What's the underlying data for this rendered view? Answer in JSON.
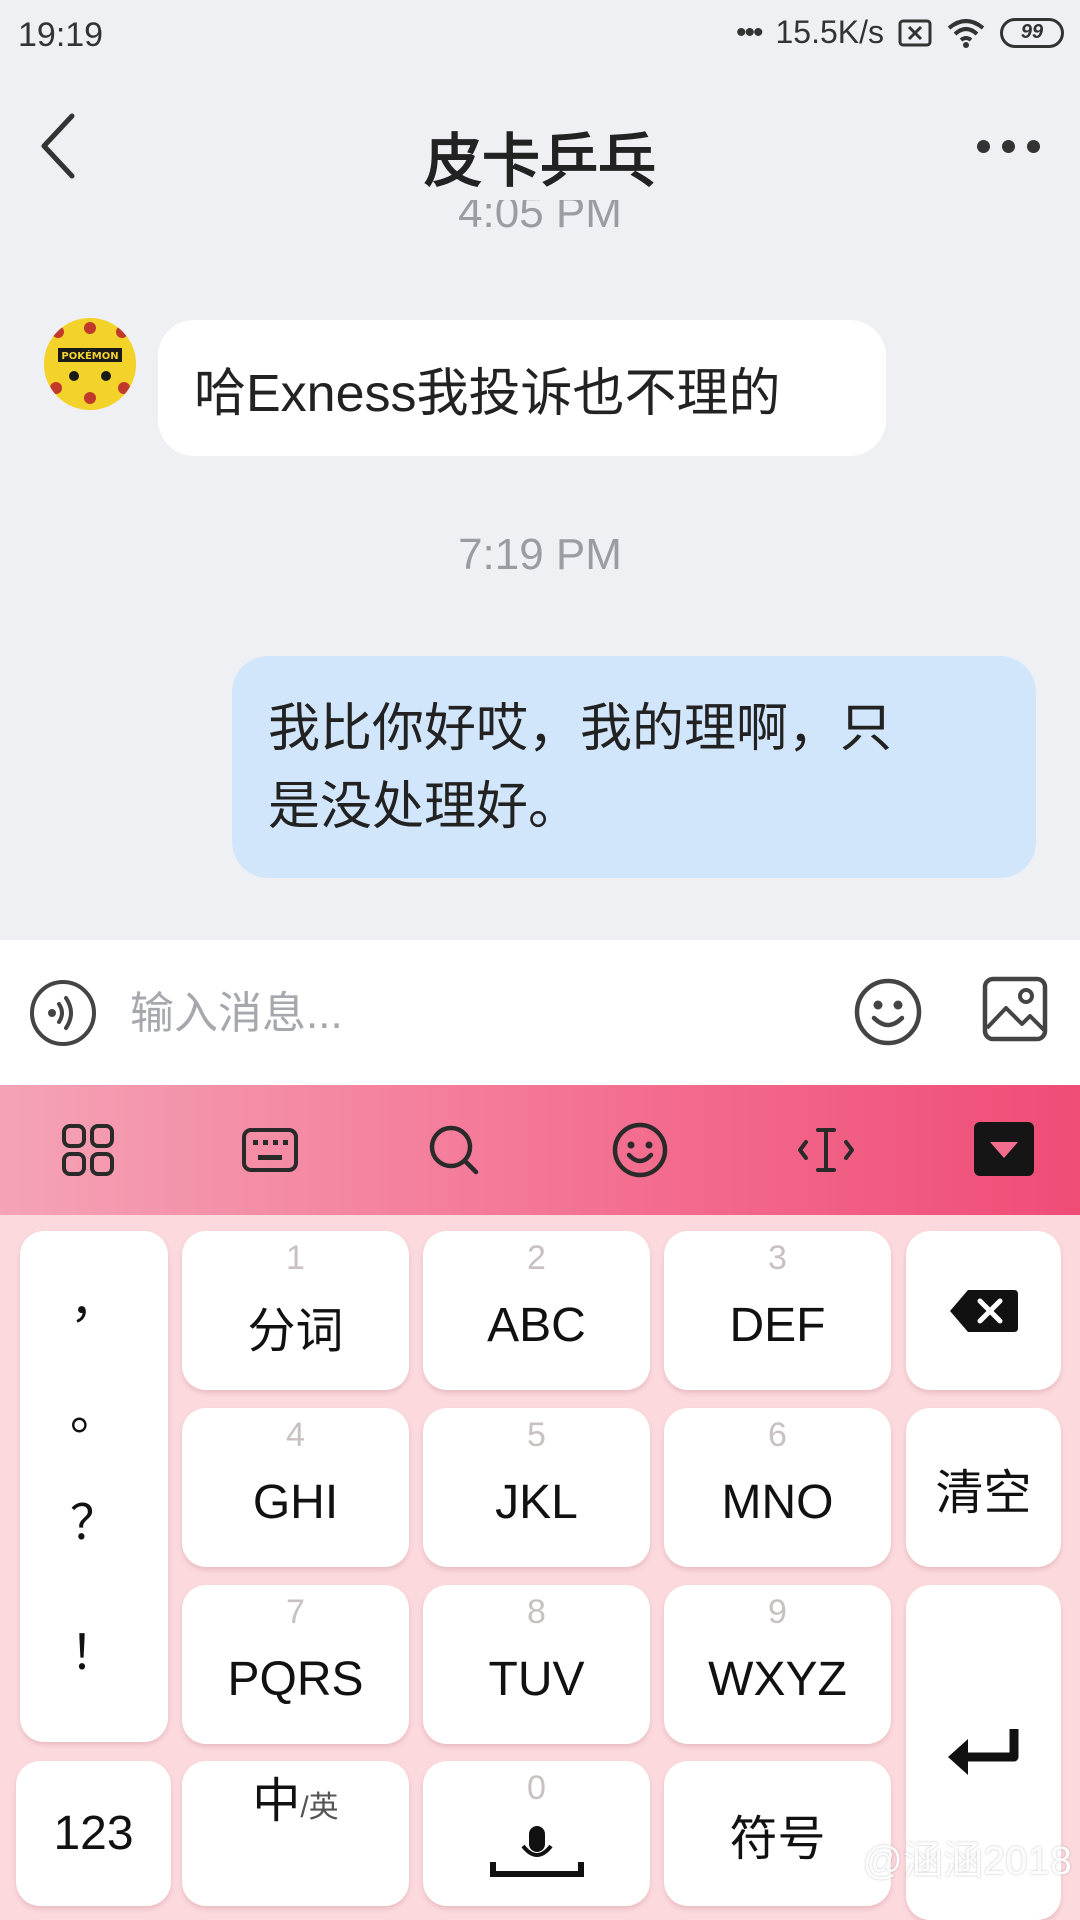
{
  "status_bar": {
    "time": "19:19",
    "network_speed": "15.5K/s",
    "battery_level": "99",
    "icons": [
      "signal-dots-icon",
      "sim-x-icon",
      "wifi-icon",
      "battery-icon"
    ]
  },
  "header": {
    "title": "皮卡乒乓",
    "back_icon": "chevron-left-icon",
    "more_icon": "more-dots-icon"
  },
  "messages": {
    "timestamp_top": "4:05 PM",
    "incoming_text": "哈Exness我投诉也不理的",
    "timestamp_mid": "7:19 PM",
    "outgoing_line1": "我比你好哎，我的理啊，只",
    "outgoing_line2": "是没处理好。",
    "avatar_text": "POKÉMON"
  },
  "input_bar": {
    "placeholder": "输入消息..."
  },
  "keyboard": {
    "toolbar_icons": [
      "grid-icon",
      "keyboard-icon",
      "search-icon",
      "smiley-icon",
      "text-cursor-icon",
      "collapse-keyboard-icon"
    ],
    "punctuation": [
      "，",
      "。",
      "？",
      "！"
    ],
    "keys": [
      {
        "num": "1",
        "label": "分词"
      },
      {
        "num": "2",
        "label": "ABC"
      },
      {
        "num": "3",
        "label": "DEF"
      },
      {
        "num": "4",
        "label": "GHI"
      },
      {
        "num": "5",
        "label": "JKL"
      },
      {
        "num": "6",
        "label": "MNO"
      },
      {
        "num": "7",
        "label": "PQRS"
      },
      {
        "num": "8",
        "label": "TUV"
      },
      {
        "num": "9",
        "label": "WXYZ"
      },
      {
        "num": "0",
        "label": ""
      }
    ],
    "clear_label": "清空",
    "numbers_label": "123",
    "lang_main": "中",
    "lang_sub": "/英",
    "symbols_label": "符号",
    "accent_color": "#f36d8f"
  },
  "watermark": "@涵涵2018"
}
